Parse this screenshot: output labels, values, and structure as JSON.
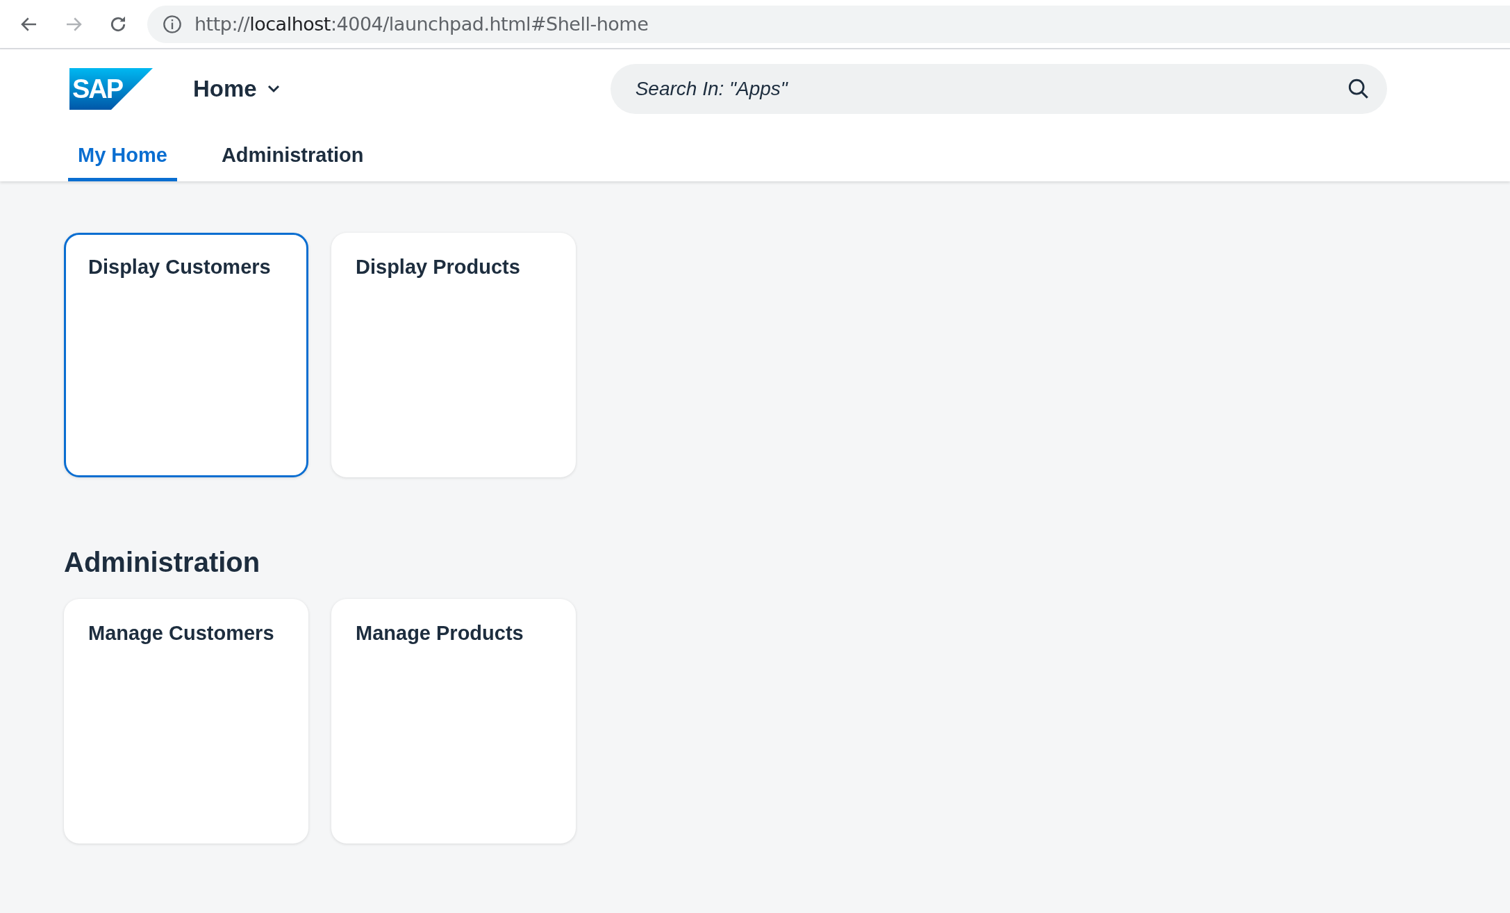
{
  "browser": {
    "url": {
      "prefix": "http://",
      "host": "localhost",
      "suffix": ":4004/launchpad.html#Shell-home"
    }
  },
  "shell": {
    "logo": "SAP",
    "title": "Home",
    "search": {
      "placeholder": "Search In: \"Apps\""
    }
  },
  "tabs": [
    {
      "label": "My Home",
      "selected": true
    },
    {
      "label": "Administration",
      "selected": false
    }
  ],
  "sections": [
    {
      "tiles": [
        {
          "title": "Display Customers",
          "focused": true
        },
        {
          "title": "Display Products",
          "focused": false
        }
      ]
    },
    {
      "title": "Administration",
      "tiles": [
        {
          "title": "Manage Customers",
          "focused": false
        },
        {
          "title": "Manage Products",
          "focused": false
        }
      ]
    }
  ]
}
